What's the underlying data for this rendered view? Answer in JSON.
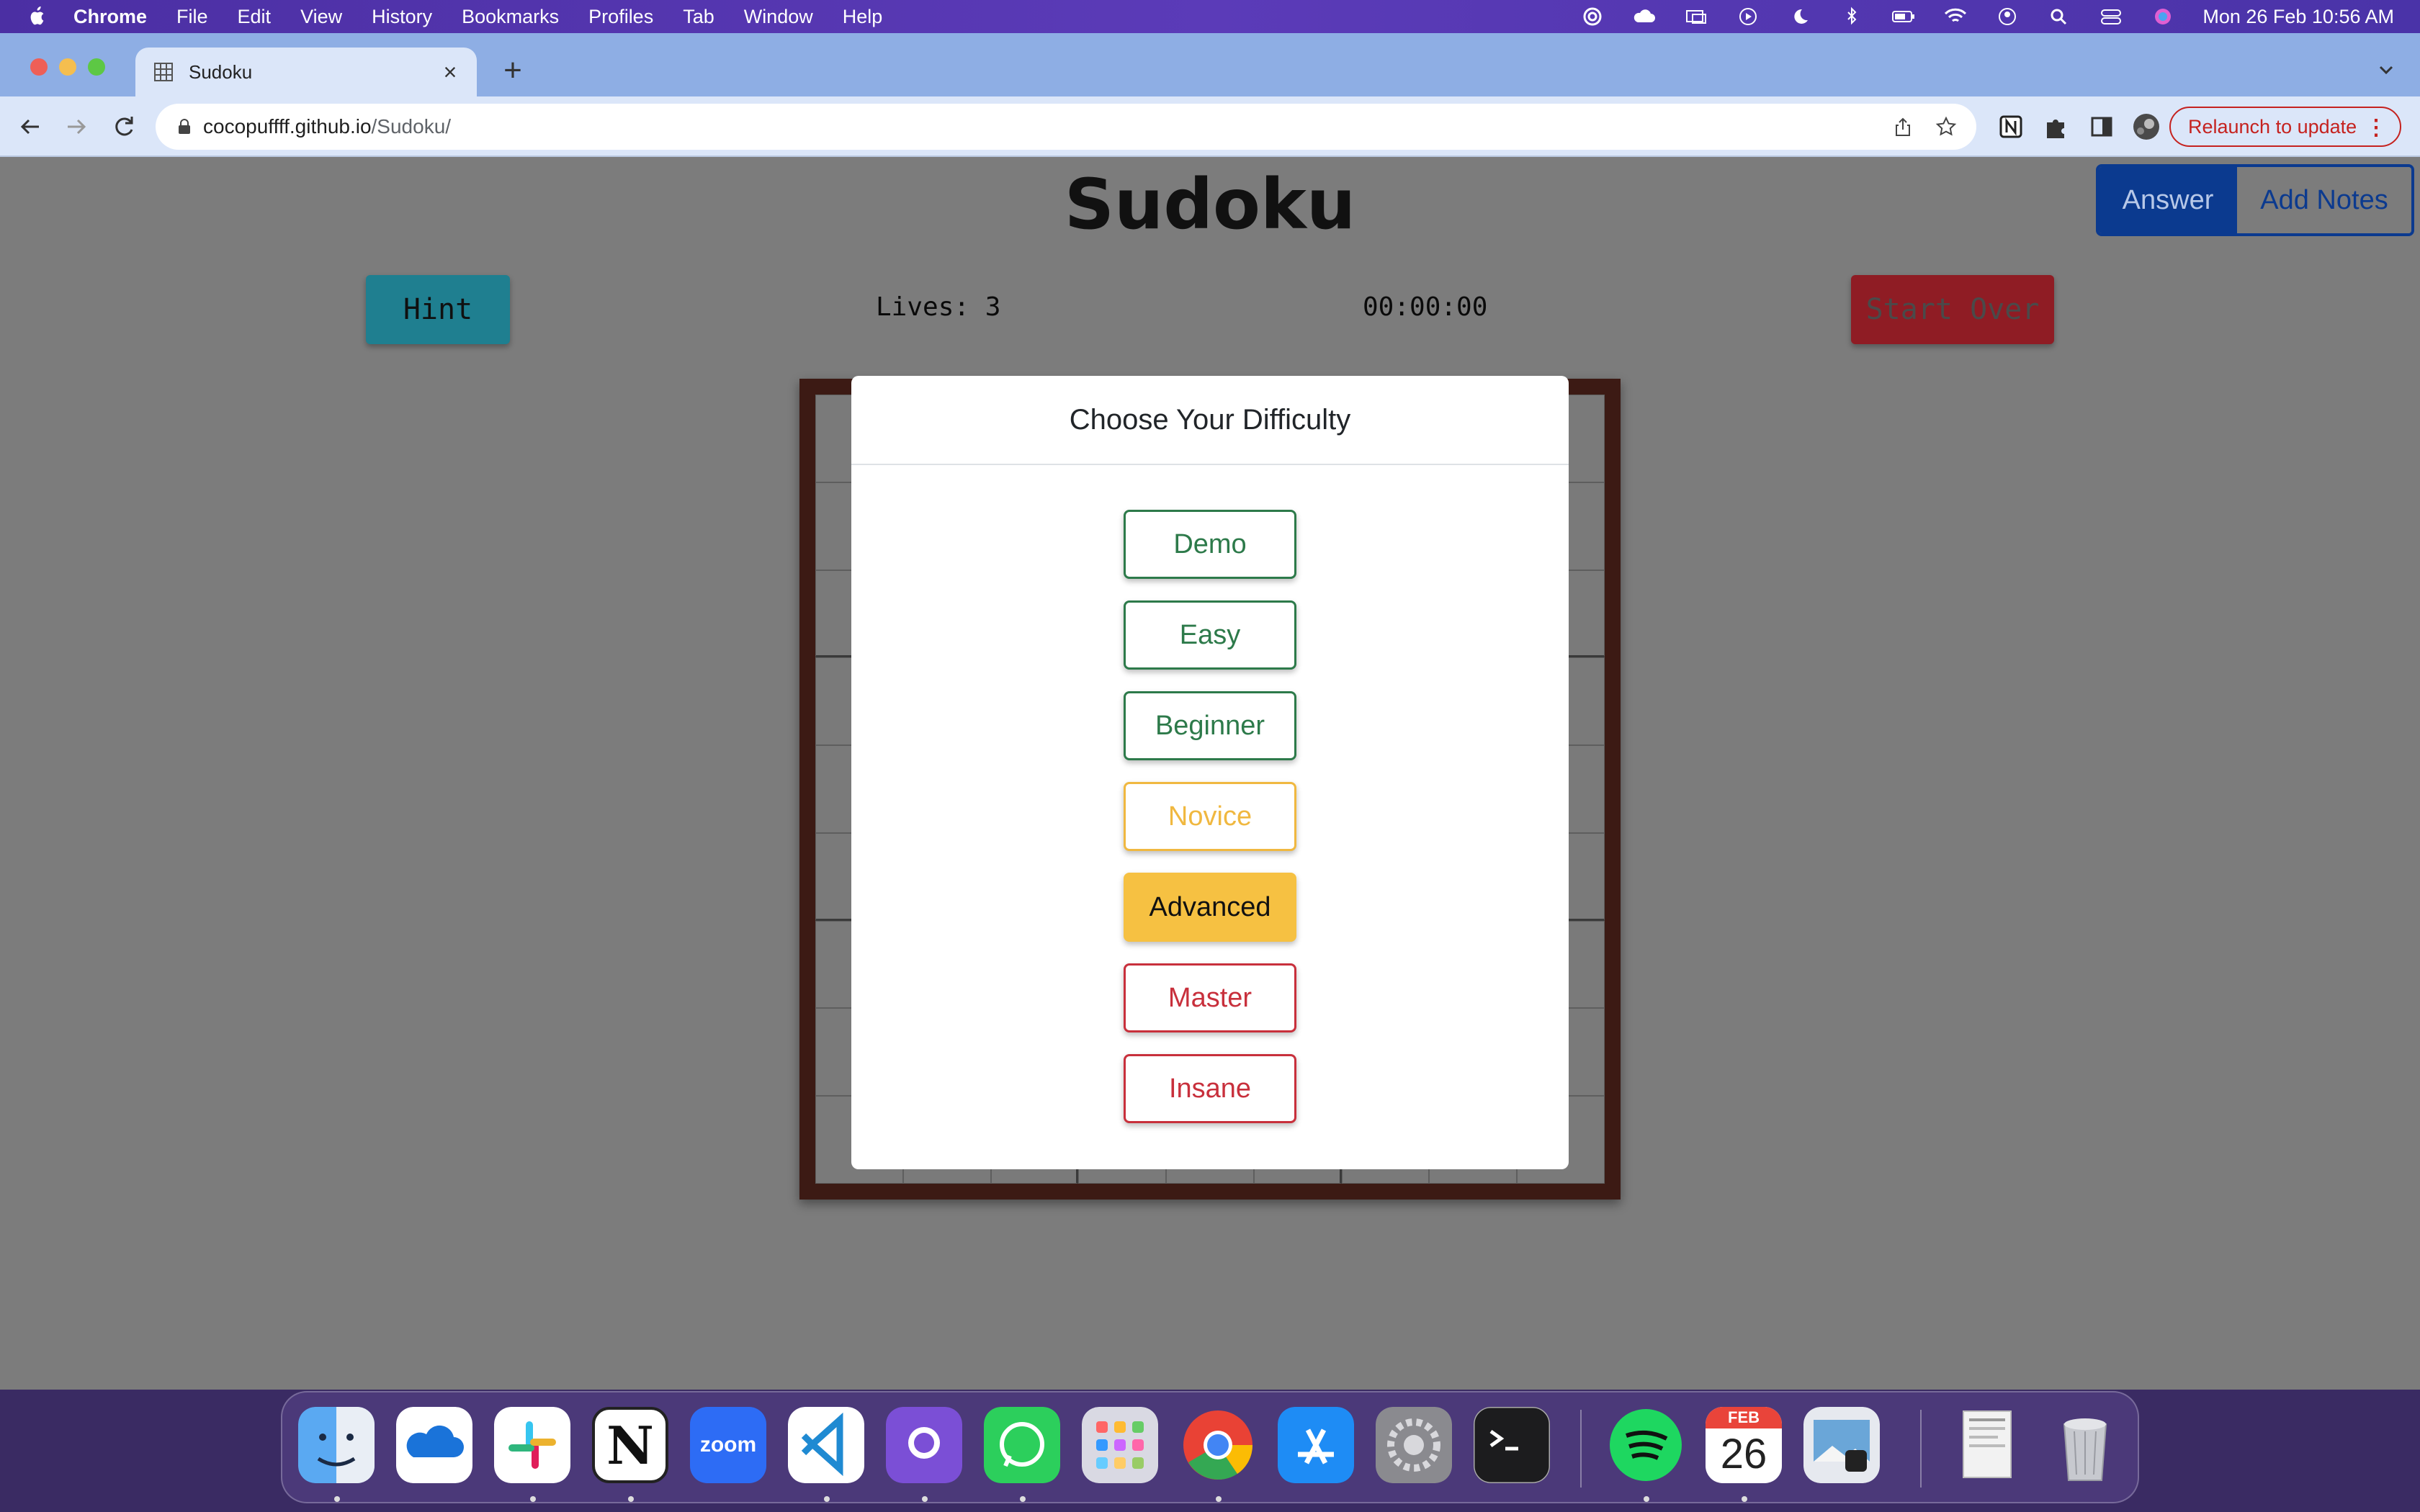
{
  "menubar": {
    "app": "Chrome",
    "items": [
      "File",
      "Edit",
      "View",
      "History",
      "Bookmarks",
      "Profiles",
      "Tab",
      "Window",
      "Help"
    ],
    "clock": "Mon 26 Feb  10:56 AM"
  },
  "browser": {
    "tab_title": "Sudoku",
    "url_host": "cocopuffff.github.io",
    "url_path": "/Sudoku/",
    "relaunch_label": "Relaunch to update"
  },
  "game": {
    "title": "Sudoku",
    "hint_label": "Hint",
    "lives": "Lives: 3",
    "timer": "00:00:00",
    "start_over_label": "Start Over",
    "answer_label": "Answer",
    "add_notes_label": "Add Notes"
  },
  "modal": {
    "title": "Choose Your Difficulty",
    "options": [
      "Demo",
      "Easy",
      "Beginner",
      "Novice",
      "Advanced",
      "Master",
      "Insane"
    ]
  },
  "dock": {
    "apps": [
      "Finder",
      "OneDrive",
      "Slack",
      "Notion",
      "Zoom",
      "Visual Studio Code",
      "GitHub Desktop",
      "WhatsApp",
      "Launchpad",
      "Google Chrome",
      "App Store",
      "System Settings",
      "Terminal",
      "Spotify",
      "Calendar",
      "Preview",
      "Documents",
      "Trash"
    ],
    "zoom_label": "zoom",
    "calendar_month": "FEB",
    "calendar_day": "26",
    "notion_letter": "N"
  }
}
